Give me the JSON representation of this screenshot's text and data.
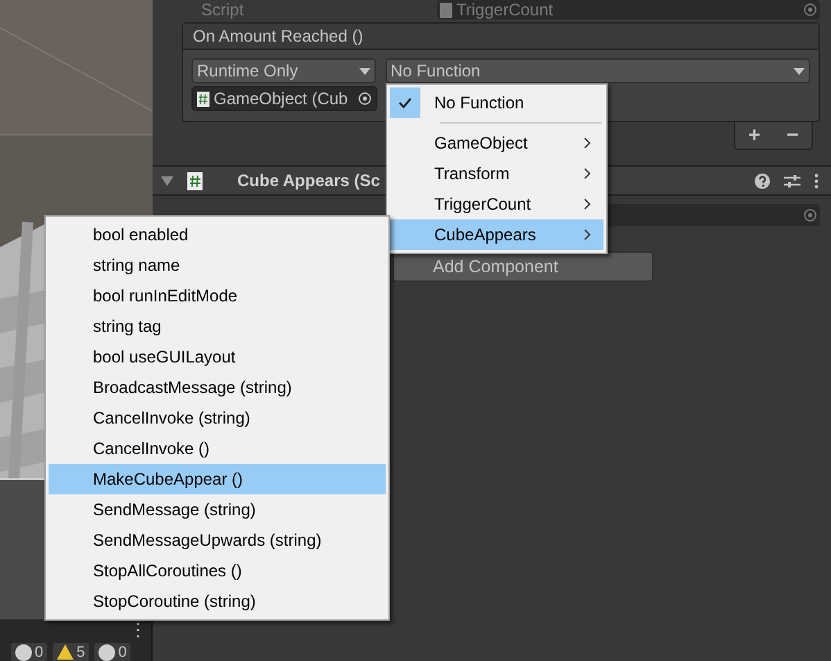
{
  "scene": {
    "kind": "picture",
    "more_icon": "⋮",
    "counters": [
      {
        "kind": "info",
        "count": "0"
      },
      {
        "kind": "warning",
        "count": "5"
      },
      {
        "kind": "error",
        "count": "0"
      }
    ]
  },
  "inspector": {
    "script_label": "Script",
    "script_value": "TriggerCount",
    "event": {
      "title": "On Amount Reached ()",
      "mode": "Runtime Only",
      "function": "No Function",
      "target": "GameObject (Cub",
      "add": "+",
      "remove": "−"
    },
    "component": {
      "title": "Cube Appears (Sc",
      "expanded": true
    },
    "add_component": "Add Component"
  },
  "function_menu": [
    {
      "kind": "item",
      "label": "No Function",
      "checked": true,
      "selected": false,
      "submenu": false
    },
    {
      "kind": "separator"
    },
    {
      "kind": "item",
      "label": "GameObject",
      "checked": false,
      "selected": false,
      "submenu": true
    },
    {
      "kind": "item",
      "label": "Transform",
      "checked": false,
      "selected": false,
      "submenu": true
    },
    {
      "kind": "item",
      "label": "TriggerCount",
      "checked": false,
      "selected": false,
      "submenu": true
    },
    {
      "kind": "item",
      "label": "CubeAppears",
      "checked": false,
      "selected": true,
      "submenu": true
    }
  ],
  "submenu": [
    {
      "label": "bool enabled",
      "selected": false
    },
    {
      "label": "string name",
      "selected": false
    },
    {
      "label": "bool runInEditMode",
      "selected": false
    },
    {
      "label": "string tag",
      "selected": false
    },
    {
      "label": "bool useGUILayout",
      "selected": false
    },
    {
      "label": "BroadcastMessage (string)",
      "selected": false
    },
    {
      "label": "CancelInvoke (string)",
      "selected": false
    },
    {
      "label": "CancelInvoke ()",
      "selected": false
    },
    {
      "label": "MakeCubeAppear ()",
      "selected": true
    },
    {
      "label": "SendMessage (string)",
      "selected": false
    },
    {
      "label": "SendMessageUpwards (string)",
      "selected": false
    },
    {
      "label": "StopAllCoroutines ()",
      "selected": false
    },
    {
      "label": "StopCoroutine (string)",
      "selected": false
    }
  ]
}
